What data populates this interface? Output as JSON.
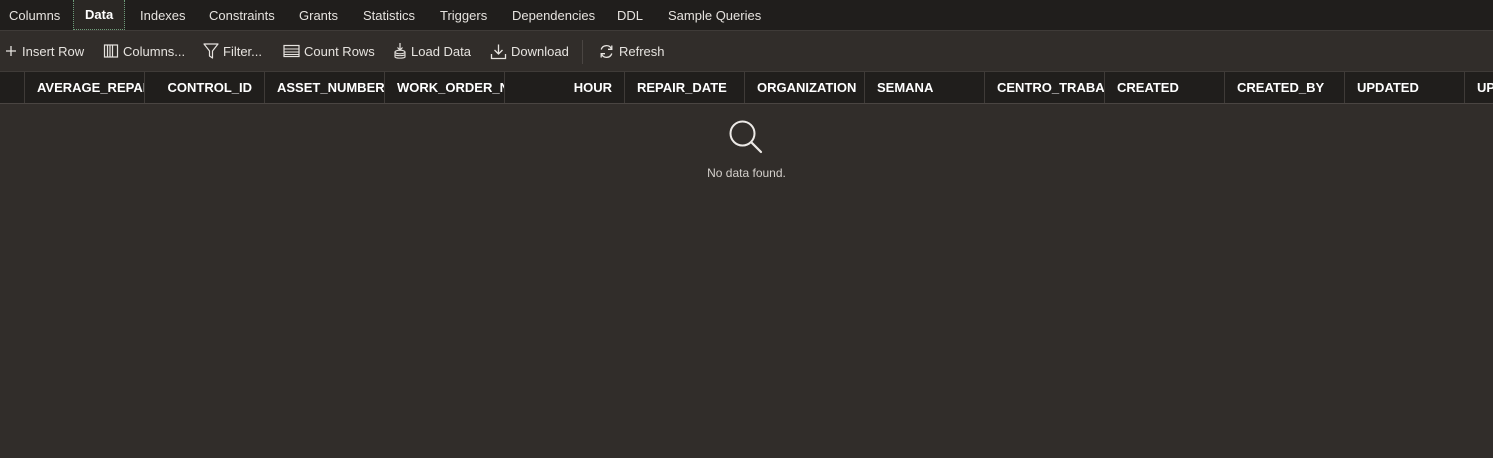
{
  "tabs": [
    {
      "label": "Columns"
    },
    {
      "label": "Data",
      "active": true
    },
    {
      "label": "Indexes"
    },
    {
      "label": "Constraints"
    },
    {
      "label": "Grants"
    },
    {
      "label": "Statistics"
    },
    {
      "label": "Triggers"
    },
    {
      "label": "Dependencies"
    },
    {
      "label": "DDL"
    },
    {
      "label": "Sample Queries"
    }
  ],
  "toolbar": {
    "insert_row": {
      "label": "Insert Row",
      "icon": "plus-icon"
    },
    "columns": {
      "label": "Columns...",
      "icon": "columns-icon"
    },
    "filter": {
      "label": "Filter...",
      "icon": "filter-icon"
    },
    "count_rows": {
      "label": "Count Rows",
      "icon": "count-rows-icon"
    },
    "load_data": {
      "label": "Load Data",
      "icon": "load-data-icon"
    },
    "download": {
      "label": "Download",
      "icon": "download-icon"
    },
    "refresh": {
      "label": "Refresh",
      "icon": "refresh-icon"
    }
  },
  "grid": {
    "columns": [
      "AVERAGE_REPAIR_",
      "CONTROL_ID",
      "ASSET_NUMBER...",
      "WORK_ORDER_NU",
      "HOUR",
      "REPAIR_DATE",
      "ORGANIZATION",
      "SEMANA",
      "CENTRO_TRABAJO",
      "CREATED",
      "CREATED_BY",
      "UPDATED",
      "UP"
    ],
    "empty_message": "No data found.",
    "empty_icon": "search-icon"
  },
  "colors": {
    "background": "#312d2a",
    "tabs_background": "#201e1c",
    "header_background": "#201e1c",
    "active_tab_border": "#6c9a78"
  }
}
